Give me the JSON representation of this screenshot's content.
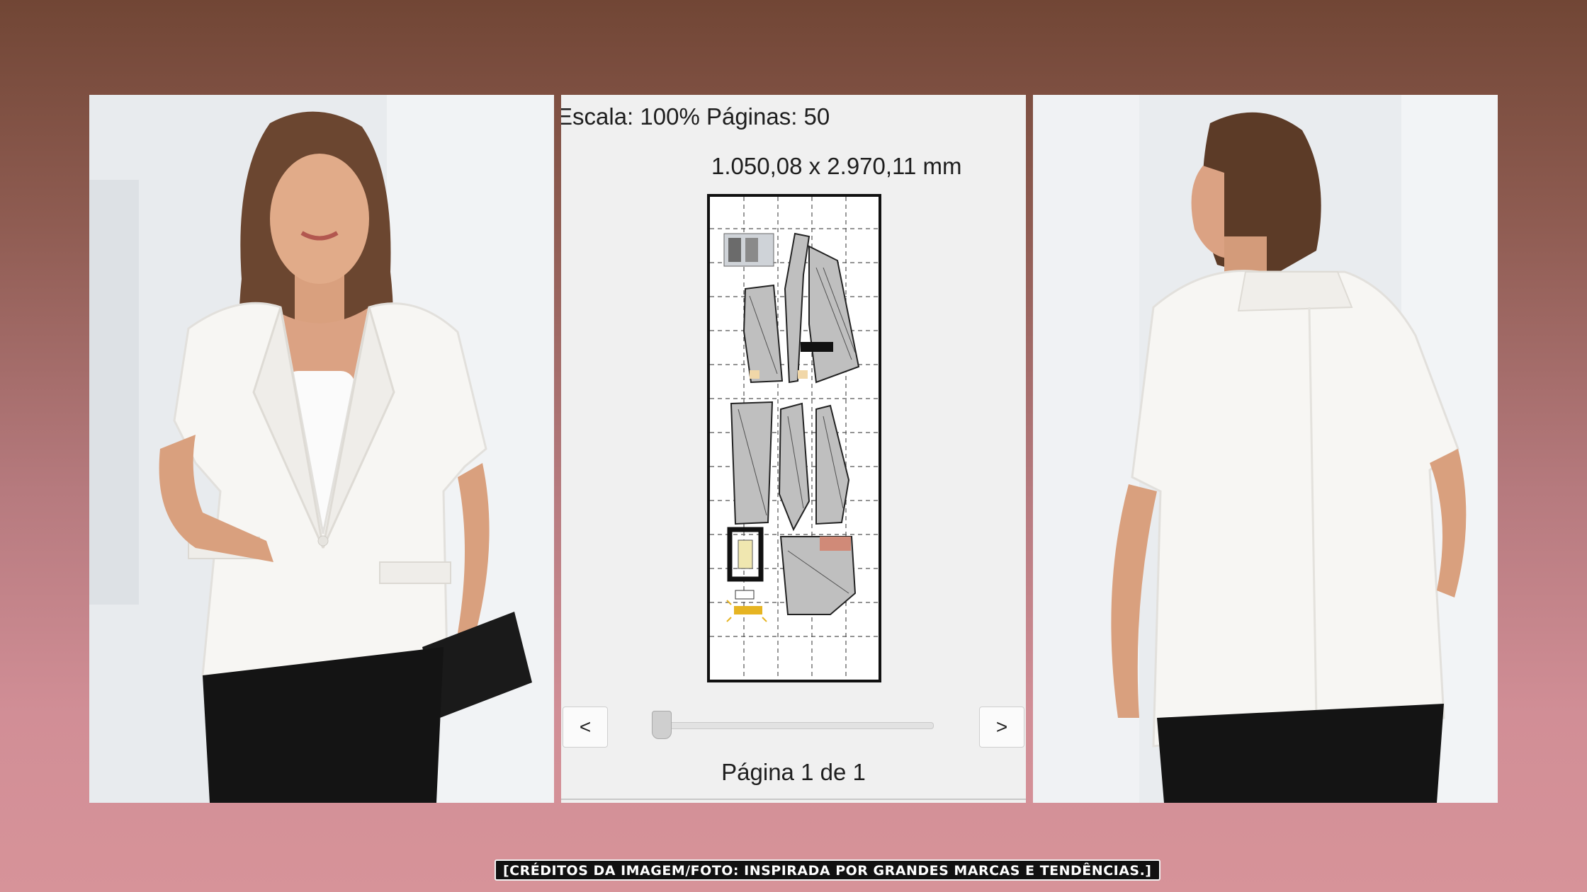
{
  "preview": {
    "scale_text": "Escala: 100% Páginas: 50",
    "dimensions_text": "1.050,08 x 2.970,11 mm",
    "prev_label": "<",
    "next_label": ">",
    "page_indicator": "Página 1 de 1",
    "page_slider_position": 0
  },
  "credits": "[CRÉDITOS DA IMAGEM/FOTO: INSPIRADA POR GRANDES MARCAS E TENDÊNCIAS.]",
  "colors": {
    "background_top": "#714635",
    "background_bottom": "#d79399",
    "preview_bg": "#f0f0f0",
    "blazer_white": "#f7f6f3",
    "trousers_black": "#141414"
  }
}
